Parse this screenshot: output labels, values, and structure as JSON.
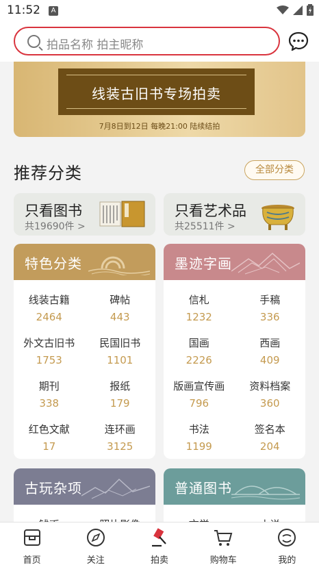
{
  "status": {
    "time": "11:52",
    "a_badge": "A"
  },
  "search": {
    "placeholder": "拍品名称 拍主昵称"
  },
  "banner": {
    "title": "线装古旧书专场拍卖",
    "subtitle": "7月8日到12日 每晚21:00 陆续结拍"
  },
  "section": {
    "title": "推荐分类",
    "all_label": "全部分类"
  },
  "quick": [
    {
      "title": "只看图书",
      "count": "共19690件 >"
    },
    {
      "title": "只看艺术品",
      "count": "共25511件 >"
    }
  ],
  "panels": [
    {
      "title": "特色分类",
      "items": [
        {
          "name": "线装古籍",
          "count": "2464"
        },
        {
          "name": "碑帖",
          "count": "443"
        },
        {
          "name": "外文古旧书",
          "count": "1753"
        },
        {
          "name": "民国旧书",
          "count": "1101"
        },
        {
          "name": "期刊",
          "count": "338"
        },
        {
          "name": "报纸",
          "count": "179"
        },
        {
          "name": "红色文献",
          "count": "17"
        },
        {
          "name": "连环画",
          "count": "3125"
        }
      ]
    },
    {
      "title": "墨迹字画",
      "items": [
        {
          "name": "信札",
          "count": "1232"
        },
        {
          "name": "手稿",
          "count": "336"
        },
        {
          "name": "国画",
          "count": "2226"
        },
        {
          "name": "西画",
          "count": "409"
        },
        {
          "name": "版画宣传画",
          "count": "796"
        },
        {
          "name": "资料档案",
          "count": "360"
        },
        {
          "name": "书法",
          "count": "1199"
        },
        {
          "name": "签名本",
          "count": "204"
        }
      ]
    },
    {
      "title": "古玩杂项",
      "items": [
        {
          "name": "钱币"
        },
        {
          "name": "照片影像"
        }
      ]
    },
    {
      "title": "普通图书",
      "items": [
        {
          "name": "文学"
        },
        {
          "name": "小说"
        }
      ]
    }
  ],
  "tabs": [
    {
      "label": "首页",
      "icon": "home-icon"
    },
    {
      "label": "关注",
      "icon": "compass-icon"
    },
    {
      "label": "拍卖",
      "icon": "gavel-icon"
    },
    {
      "label": "购物车",
      "icon": "cart-icon"
    },
    {
      "label": "我的",
      "icon": "user-icon"
    }
  ],
  "colors": {
    "accent_red": "#d9333d",
    "gold": "#c49a4f",
    "panel_gold": "#c29c5c",
    "panel_rose": "#c8898c",
    "panel_slate": "#7c7d92",
    "panel_teal": "#6c9d9b"
  }
}
